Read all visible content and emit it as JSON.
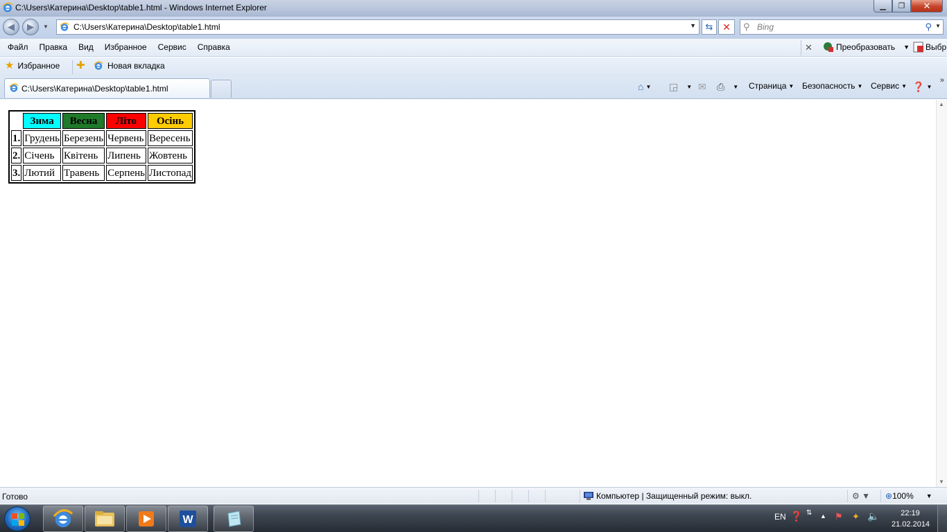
{
  "window": {
    "title": "C:\\Users\\Катерина\\Desktop\\table1.html - Windows Internet Explorer"
  },
  "address_bar": {
    "url": "C:\\Users\\Катерина\\Desktop\\table1.html"
  },
  "search": {
    "placeholder": "Bing"
  },
  "menu": {
    "items": [
      "Файл",
      "Правка",
      "Вид",
      "Избранное",
      "Сервис",
      "Справка"
    ],
    "convert_label": "Преобразовать",
    "select_label": "Выбр"
  },
  "favorites": {
    "label": "Избранное",
    "new_tab": "Новая вкладка"
  },
  "tab": {
    "label": "C:\\Users\\Катерина\\Desktop\\table1.html"
  },
  "command_bar": {
    "page": "Страница",
    "safety": "Безопасность",
    "tools": "Сервис"
  },
  "page": {
    "table": {
      "headers": [
        "Зима",
        "Весна",
        "Літо",
        "Осінь"
      ],
      "rows": [
        {
          "num": "1.",
          "cells": [
            "Грудень",
            "Березень",
            "Червень",
            "Вересень"
          ]
        },
        {
          "num": "2.",
          "cells": [
            "Січень",
            "Квітень",
            "Липень",
            "Жовтень"
          ]
        },
        {
          "num": "3.",
          "cells": [
            "Лютий",
            "Травень",
            "Серпень",
            "Листопад"
          ]
        }
      ],
      "header_colors": [
        "#00ffff",
        "#1f7a2a",
        "#ff0000",
        "#ffcc00"
      ]
    }
  },
  "status_bar": {
    "status": "Готово",
    "zone": "Компьютер | Защищенный режим: выкл.",
    "zoom": "100%"
  },
  "taskbar": {
    "language": "EN",
    "time": "22:19",
    "date": "21.02.2014",
    "apps": [
      "internet-explorer",
      "file-explorer",
      "media-player",
      "word",
      "notepad"
    ]
  }
}
